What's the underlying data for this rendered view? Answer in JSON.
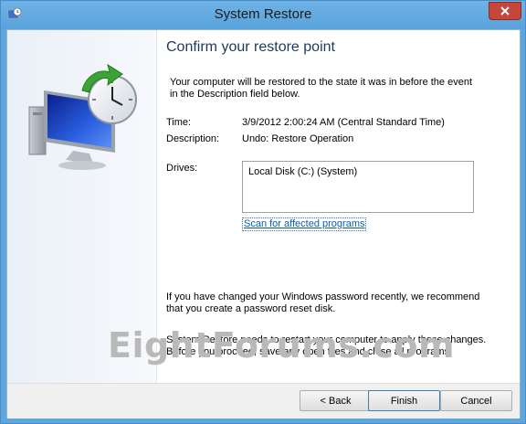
{
  "window": {
    "title": "System Restore"
  },
  "page": {
    "heading": "Confirm your restore point",
    "intro_line1": "Your computer will be restored to the state it was in before the event",
    "intro_line2": "in the Description field below.",
    "time_label": "Time:",
    "time_value": "3/9/2012 2:00:24 AM (Central Standard Time)",
    "description_label": "Description:",
    "description_value": "Undo: Restore Operation",
    "drives_label": "Drives:",
    "drives": [
      "Local Disk (C:) (System)"
    ],
    "scan_link": "Scan for affected programs",
    "password_line1": "If you have changed your Windows password recently, we recommend",
    "password_line2": "that you create a password reset disk.",
    "restart_line1": "System Restore needs to restart your computer to apply these changes.",
    "restart_line2": "Before you proceed, save any open files and close all programs."
  },
  "buttons": {
    "back": "< Back",
    "finish": "Finish",
    "cancel": "Cancel"
  },
  "watermark": "EightForums.com",
  "colors": {
    "titlebar": "#5ea6dc",
    "close": "#c7463a",
    "heading": "#1e395b",
    "link": "#0a5ea8"
  }
}
